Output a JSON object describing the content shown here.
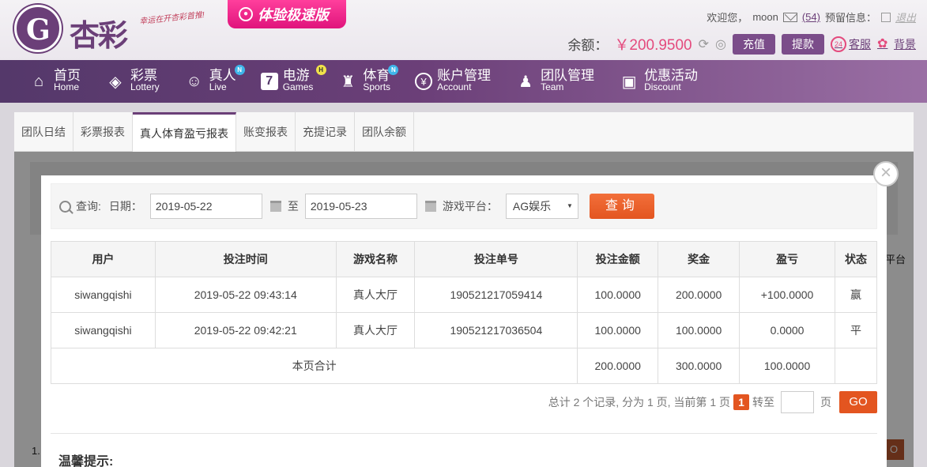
{
  "header": {
    "brand": "杏彩",
    "slogan": "幸运在开杏彩首推!",
    "speed_label": "体验极速版",
    "welcome": "欢迎您，",
    "username": "moon",
    "mail_count": "(54)",
    "notice_label": "预留信息：",
    "logout": "退出",
    "balance_label": "余额：",
    "balance_amount": "￥200.9500",
    "recharge": "充值",
    "withdraw": "提款",
    "service": "客服",
    "background": "背景"
  },
  "nav": {
    "items": [
      {
        "zh": "首页",
        "en": "Home"
      },
      {
        "zh": "彩票",
        "en": "Lottery"
      },
      {
        "zh": "真人",
        "en": "Live",
        "badge": "N"
      },
      {
        "zh": "电游",
        "en": "Games",
        "badge": "H"
      },
      {
        "zh": "体育",
        "en": "Sports",
        "badge": "N"
      },
      {
        "zh": "账户管理",
        "en": "Account"
      },
      {
        "zh": "团队管理",
        "en": "Team"
      },
      {
        "zh": "优惠活动",
        "en": "Discount"
      }
    ]
  },
  "tabs": [
    "团队日结",
    "彩票报表",
    "真人体育盈亏报表",
    "账变报表",
    "充提记录",
    "团队余额"
  ],
  "underlay": {
    "side_text": "平台",
    "go": "O",
    "num": "1."
  },
  "modal": {
    "close": "×",
    "query_label": "查询:",
    "date_label": "日期：",
    "date_from": "2019-05-22",
    "to_label": "至",
    "date_to": "2019-05-23",
    "platform_label": "游戏平台：",
    "platform_value": "AG娱乐",
    "query_button": "查询",
    "table": {
      "headers": [
        "用户",
        "投注时间",
        "游戏名称",
        "投注单号",
        "投注金额",
        "奖金",
        "盈亏",
        "状态"
      ],
      "rows": [
        [
          "siwangqishi",
          "2019-05-22 09:43:14",
          "真人大厅",
          "190521217059414",
          "100.0000",
          "200.0000",
          "+100.0000",
          "赢"
        ],
        [
          "siwangqishi",
          "2019-05-22 09:42:21",
          "真人大厅",
          "190521217036504",
          "100.0000",
          "100.0000",
          "0.0000",
          "平"
        ]
      ],
      "summary_label": "本页合计",
      "summary_bet": "200.0000",
      "summary_bonus": "300.0000",
      "summary_profit": "100.0000"
    },
    "pager": {
      "summary": "总计 2 个记录, 分为 1 页, 当前第 1 页",
      "current": "1",
      "goto_label": "转至",
      "page_suffix": "页",
      "go": "GO"
    },
    "tips_title": "温馨提示:"
  }
}
